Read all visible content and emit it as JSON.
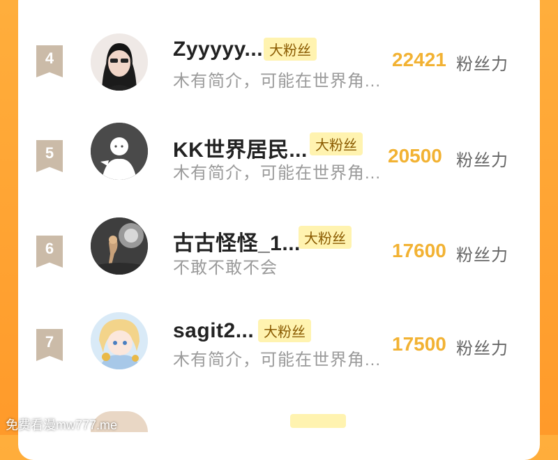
{
  "watermark": "免费看漫mw777.me",
  "badge_label": "大粉丝",
  "unit_label": "粉丝力",
  "rows": [
    {
      "rank": "4",
      "name": "Zyyyyy...",
      "bio": "木有简介，可能在世界角...",
      "score": "22421"
    },
    {
      "rank": "5",
      "name": "KK世界居民...",
      "bio": "木有简介，可能在世界角...",
      "score": "20500"
    },
    {
      "rank": "6",
      "name": "古古怪怪_1...",
      "bio": "不敢不敢不会",
      "score": "17600"
    },
    {
      "rank": "7",
      "name": "sagit2...",
      "bio": "木有简介，可能在世界角...",
      "score": "17500"
    }
  ],
  "colors": {
    "background": "#ff9a2a",
    "score": "#f2b233",
    "badge": "#fff3b0",
    "rank": "#cbbba8"
  }
}
